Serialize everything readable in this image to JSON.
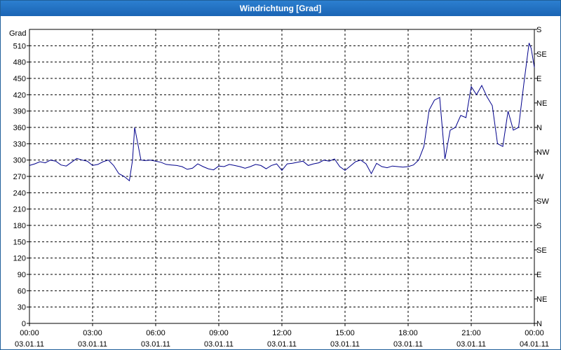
{
  "window": {
    "title": "Windrichtung [Grad]"
  },
  "chart_data": {
    "type": "line",
    "title": "Windrichtung [Grad]",
    "ylabel": "Grad",
    "xlabel": "",
    "ylim": [
      0,
      540
    ],
    "xlim": [
      0,
      24
    ],
    "grid": true,
    "line_color": "#00008b",
    "y_ticks": [
      0,
      30,
      60,
      90,
      120,
      150,
      180,
      210,
      240,
      270,
      300,
      330,
      360,
      390,
      420,
      450,
      480,
      510
    ],
    "y2_ticks": [
      {
        "value": 0,
        "label": "N"
      },
      {
        "value": 45,
        "label": "NE"
      },
      {
        "value": 90,
        "label": "E"
      },
      {
        "value": 135,
        "label": "SE"
      },
      {
        "value": 180,
        "label": "S"
      },
      {
        "value": 225,
        "label": "SW"
      },
      {
        "value": 270,
        "label": "W"
      },
      {
        "value": 315,
        "label": "NW"
      },
      {
        "value": 360,
        "label": "N"
      },
      {
        "value": 405,
        "label": "NE"
      },
      {
        "value": 450,
        "label": "E"
      },
      {
        "value": 495,
        "label": "SE"
      },
      {
        "value": 540,
        "label": "S"
      }
    ],
    "x_ticks": [
      {
        "value": 0,
        "time": "00:00",
        "date": "03.01.11"
      },
      {
        "value": 3,
        "time": "03:00",
        "date": "03.01.11"
      },
      {
        "value": 6,
        "time": "06:00",
        "date": "03.01.11"
      },
      {
        "value": 9,
        "time": "09:00",
        "date": "03.01.11"
      },
      {
        "value": 12,
        "time": "12:00",
        "date": "03.01.11"
      },
      {
        "value": 15,
        "time": "15:00",
        "date": "03.01.11"
      },
      {
        "value": 18,
        "time": "18:00",
        "date": "03.01.11"
      },
      {
        "value": 21,
        "time": "21:00",
        "date": "03.01.11"
      },
      {
        "value": 24,
        "time": "00:00",
        "date": "04.01.11"
      }
    ],
    "series": [
      {
        "x": [
          0,
          0.25,
          0.5,
          0.75,
          1.0,
          1.25,
          1.5,
          1.75,
          2.0,
          2.25,
          2.5,
          2.75,
          3.0,
          3.25,
          3.5,
          3.75,
          4.0,
          4.25,
          4.5,
          4.75,
          4.9,
          5.0,
          5.15,
          5.3,
          5.5,
          5.75,
          6.0,
          6.25,
          6.5,
          6.75,
          7.0,
          7.25,
          7.5,
          7.75,
          8.0,
          8.25,
          8.5,
          8.75,
          9.0,
          9.25,
          9.5,
          9.75,
          10.0,
          10.25,
          10.5,
          10.75,
          11.0,
          11.25,
          11.5,
          11.75,
          12.0,
          12.25,
          12.5,
          12.75,
          13.0,
          13.25,
          13.5,
          13.75,
          14.0,
          14.25,
          14.5,
          14.75,
          15.0,
          15.25,
          15.5,
          15.75,
          16.0,
          16.25,
          16.5,
          16.75,
          17.0,
          17.25,
          17.5,
          17.75,
          18.0,
          18.25,
          18.5,
          18.75,
          19.0,
          19.25,
          19.5,
          19.75,
          20.0,
          20.25,
          20.5,
          20.75,
          21.0,
          21.25,
          21.5,
          21.75,
          22.0,
          22.25,
          22.5,
          22.75,
          23.0,
          23.25,
          23.5,
          23.75,
          23.85,
          24.0
        ],
        "y": [
          290,
          293,
          297,
          295,
          300,
          298,
          291,
          289,
          296,
          303,
          300,
          298,
          290,
          292,
          297,
          300,
          290,
          275,
          270,
          262,
          300,
          360,
          330,
          300,
          299,
          300,
          298,
          296,
          292,
          291,
          290,
          288,
          283,
          285,
          293,
          288,
          284,
          282,
          289,
          288,
          292,
          290,
          288,
          285,
          288,
          292,
          290,
          284,
          290,
          293,
          281,
          293,
          294,
          296,
          298,
          290,
          293,
          295,
          300,
          298,
          302,
          288,
          281,
          289,
          297,
          300,
          293,
          275,
          294,
          288,
          286,
          289,
          288,
          287,
          288,
          291,
          300,
          325,
          392,
          410,
          415,
          302,
          355,
          360,
          382,
          378,
          435,
          420,
          437,
          416,
          400,
          330,
          325,
          390,
          355,
          360,
          440,
          515,
          505,
          470
        ]
      }
    ]
  }
}
